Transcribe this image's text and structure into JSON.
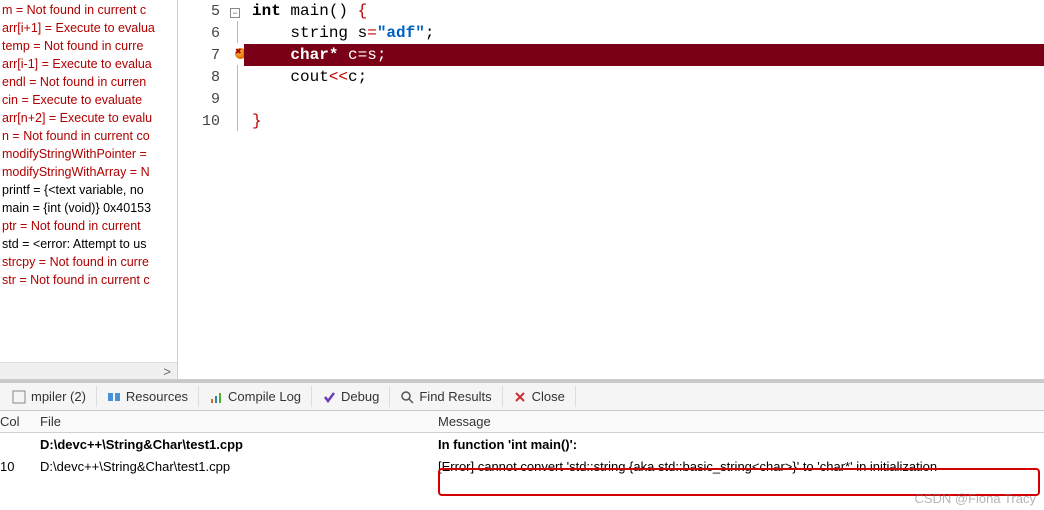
{
  "sidebar": {
    "items": [
      {
        "text": "m = Not found in current c",
        "red": true
      },
      {
        "text": "arr[i+1] = Execute to evalua",
        "red": true
      },
      {
        "text": "temp = Not found in curre",
        "red": true
      },
      {
        "text": "arr[i-1] = Execute to evalua",
        "red": true
      },
      {
        "text": "endl = Not found in curren",
        "red": true
      },
      {
        "text": "cin = Execute to evaluate",
        "red": true
      },
      {
        "text": "arr[n+2] = Execute to evalu",
        "red": true
      },
      {
        "text": "n = Not found in current co",
        "red": true
      },
      {
        "text": "modifyStringWithPointer =",
        "red": true
      },
      {
        "text": "modifyStringWithArray = N",
        "red": true
      },
      {
        "text": "printf = {<text variable, no",
        "red": false
      },
      {
        "text": "main = {int (void)} 0x40153",
        "red": false
      },
      {
        "text": "ptr = Not found in current",
        "red": true
      },
      {
        "text": "std = <error: Attempt to us",
        "red": false
      },
      {
        "text": "strcpy = Not found in curre",
        "red": true
      },
      {
        "text": "str = Not found in current c",
        "red": true
      }
    ],
    "scroll_arrow": ">"
  },
  "editor": {
    "lines": [
      {
        "num": "5",
        "fold": true,
        "bp": false,
        "err": false,
        "tokens": [
          {
            "t": "int",
            "c": "kw"
          },
          {
            "t": " ",
            "c": ""
          },
          {
            "t": "main",
            "c": "id"
          },
          {
            "t": "()",
            "c": "id"
          },
          {
            "t": " ",
            "c": ""
          },
          {
            "t": "{",
            "c": "brace"
          }
        ]
      },
      {
        "num": "6",
        "fold": false,
        "bp": false,
        "err": false,
        "tokens": [
          {
            "t": "    string s",
            "c": "id"
          },
          {
            "t": "=",
            "c": "op"
          },
          {
            "t": "\"adf\"",
            "c": "str"
          },
          {
            "t": ";",
            "c": "id"
          }
        ]
      },
      {
        "num": "7",
        "fold": false,
        "bp": true,
        "err": true,
        "tokens": [
          {
            "t": "    ",
            "c": ""
          },
          {
            "t": "char*",
            "c": "kw"
          },
          {
            "t": " c",
            "c": "id"
          },
          {
            "t": "=",
            "c": "op"
          },
          {
            "t": "s",
            "c": "id"
          },
          {
            "t": ";",
            "c": "id"
          }
        ]
      },
      {
        "num": "8",
        "fold": false,
        "bp": false,
        "err": false,
        "tokens": [
          {
            "t": "    cout",
            "c": "id"
          },
          {
            "t": "<<",
            "c": "op"
          },
          {
            "t": "c",
            "c": "id"
          },
          {
            "t": ";",
            "c": "id"
          }
        ]
      },
      {
        "num": "9",
        "fold": false,
        "bp": false,
        "err": false,
        "tokens": []
      },
      {
        "num": "10",
        "fold": false,
        "bp": false,
        "err": false,
        "tokens": [
          {
            "t": "}",
            "c": "brace"
          }
        ]
      }
    ]
  },
  "tabs": [
    {
      "label": "mpiler (2)",
      "icon": "compiler"
    },
    {
      "label": "Resources",
      "icon": "resources"
    },
    {
      "label": "Compile Log",
      "icon": "compilelog"
    },
    {
      "label": "Debug",
      "icon": "debug"
    },
    {
      "label": "Find Results",
      "icon": "find"
    },
    {
      "label": "Close",
      "icon": "close"
    }
  ],
  "messages": {
    "headers": {
      "col": "Col",
      "file": "File",
      "message": "Message"
    },
    "rows": [
      {
        "line": "",
        "col": "",
        "file": "D:\\devc++\\String&Char\\test1.cpp",
        "msg": "In function 'int main()':",
        "bold": true
      },
      {
        "line": "",
        "col": "10",
        "file": "D:\\devc++\\String&Char\\test1.cpp",
        "msg": "[Error] cannot convert 'std::string {aka std::basic_string<char>}' to 'char*' in initialization",
        "bold": false
      }
    ]
  },
  "watermark": "CSDN @Fiona Tracy"
}
